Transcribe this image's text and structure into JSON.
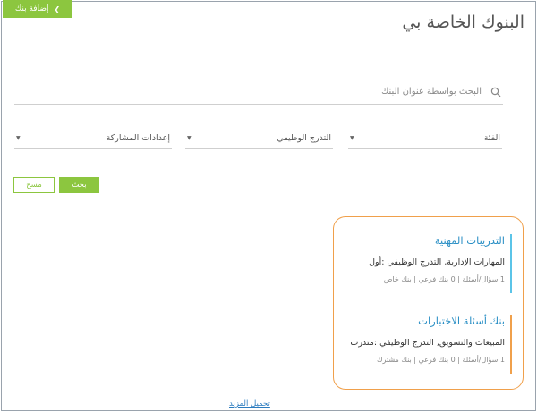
{
  "header": {
    "title": "البنوك الخاصة بي",
    "add_bank_label": "إضافة بنك",
    "add_bank_icon": "chevron-down-icon"
  },
  "search": {
    "placeholder": "البحث بواسطة عنوان البنك",
    "icon": "search-icon"
  },
  "filters": {
    "category": "الفئة",
    "career_grade": "التدرج الوظيفي",
    "sharing_settings": "إعدادات المشاركة"
  },
  "actions": {
    "search_label": "بحث",
    "clear_label": "مسح"
  },
  "banks": [
    {
      "title": "التدريبات المهنية",
      "description": "المهارات الإدارية, التدرج الوظيفي :أول",
      "meta": "1 سؤال/أسئلة | 0 بنك فرعي | بنك خاص",
      "accent": "#5bc4e8"
    },
    {
      "title": "بنك أسئلة الاختبارات",
      "description": "المبيعات والتسويق, التدرج الوظيفي :متدرب",
      "meta": "1 سؤال/أسئلة | 0 بنك فرعي | بنك مشترك",
      "accent": "#f0a04b"
    }
  ],
  "load_more_label": "تحميل المزيد",
  "colors": {
    "primary_green": "#8cc63f",
    "link_blue": "#2a8fc5",
    "highlight_orange": "#f0a04b"
  }
}
